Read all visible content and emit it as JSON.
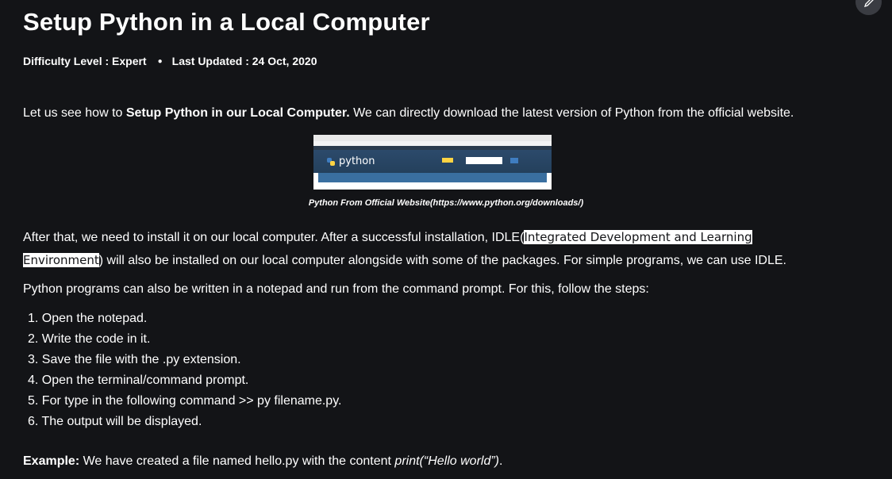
{
  "article": {
    "title": "Setup Python in a Local Computer",
    "difficulty": "Difficulty Level : Expert",
    "updated": "Last Updated : 24 Oct, 2020"
  },
  "intro": {
    "prefix": "Let us see how to ",
    "bold": "Setup Python in our Local Computer.",
    "suffix": " We can directly download the latest version of Python from the official website."
  },
  "figure": {
    "logo_text": "python",
    "caption": "Python From Official Website(https://www.python.org/downloads/)"
  },
  "install": {
    "before": "After that, we need to install it on our local computer. After a successful installation, IDLE(",
    "highlight_1": "Integrated Development and Learning",
    "highlight_2": "Environment",
    "after": ") will also be installed on our local computer alongside with some of the packages. For simple programs, we can use IDLE."
  },
  "notepad": {
    "text": "Python programs can also be written in a notepad and run from the command prompt. For this, follow the steps:"
  },
  "steps": [
    "1. Open the notepad.",
    "2. Write the code in it.",
    "3. Save the file with the .py extension.",
    "4. Open the terminal/command prompt.",
    "5. For type in the following command >> py filename.py.",
    "6. The output will be displayed."
  ],
  "example": {
    "label": "Example:",
    "text": " We have created a file named hello.py with the content ",
    "code": "print(“Hello world”)",
    "end": "."
  },
  "icons": {
    "edit": "pencil-icon",
    "bullet": "dot-icon"
  },
  "colors": {
    "background": "#131417",
    "text": "#ffffff",
    "highlight_bg": "#ffffff",
    "edit_button": "#3a3c42"
  }
}
